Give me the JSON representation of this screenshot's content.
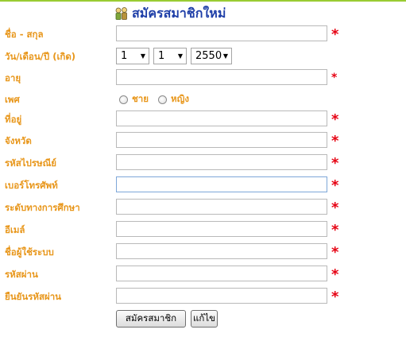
{
  "title": "สมัครสมาชิกใหม่",
  "labels": {
    "name": "ชื่อ - สกุล",
    "dob": "วัน/เดือน/ปี (เกิด)",
    "age": "อายุ",
    "gender": "เพศ",
    "address": "ที่อยู่",
    "province": "จังหวัด",
    "postal": "รหัสไปรษณีย์",
    "phone": "เบอร์โทรศัพท์",
    "education": "ระดับทางการศึกษา",
    "email": "อีเมล์",
    "username": "ชื่อผู้ใช้ระบบ",
    "password": "รหัสผ่าน",
    "confirm": "ยืนยันรหัสผ่าน"
  },
  "dob": {
    "day": "1",
    "month": "1",
    "year": "2550"
  },
  "gender": {
    "male": "ชาย",
    "female": "หญิง"
  },
  "required_mark": "*",
  "buttons": {
    "submit": "สมัครสมาชิก",
    "reset": "แก้ไข"
  },
  "colors": {
    "label": "#e8961a",
    "required": "#e60012",
    "title": "#1f3fa8",
    "top_line": "#99cc33"
  },
  "icons": {
    "title": "people-icon"
  }
}
